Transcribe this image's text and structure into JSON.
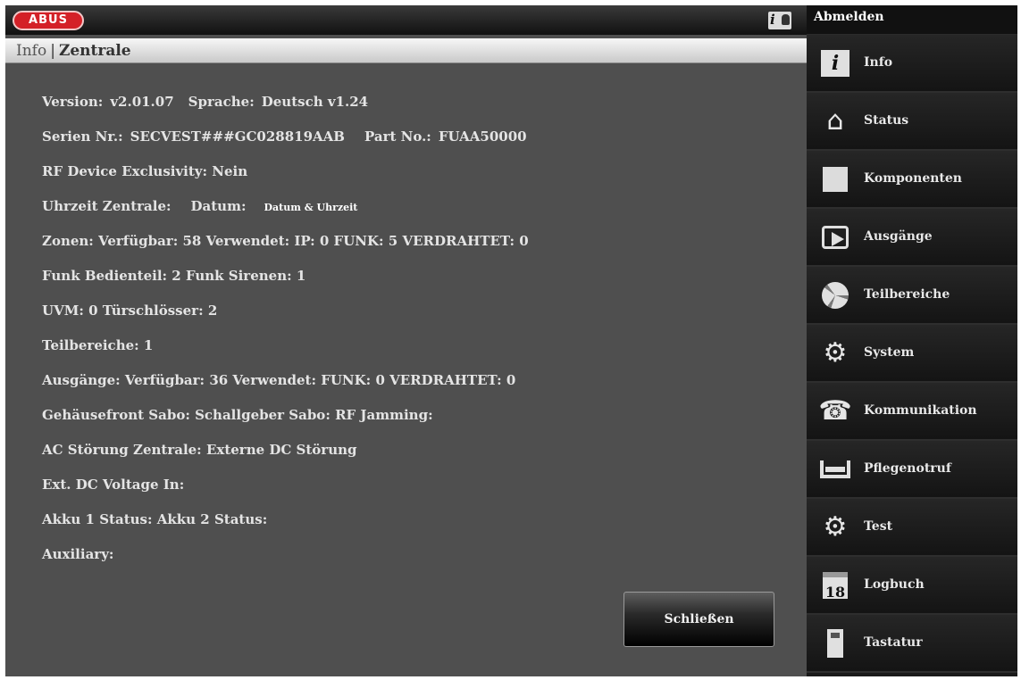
{
  "header": {
    "logo": "ABUS",
    "logout_label": "Abmelden"
  },
  "breadcrumb": {
    "parent": "Info",
    "separator": "|",
    "current": "Zentrale"
  },
  "info": {
    "version_label": "Version:",
    "version_value": "v2.01.07",
    "language_label": "Sprache:",
    "language_value": "Deutsch v1.24",
    "serial_label": "Serien Nr.:",
    "serial_value": "SECVEST###GC028819AAB",
    "part_label": "Part No.:",
    "part_value": "FUAA50000",
    "rf_exclusivity": "RF Device Exclusivity: Nein",
    "time_label": "Uhrzeit Zentrale:",
    "date_label": "Datum:",
    "datetime_value": "Datum & Uhrzeit",
    "zones": "Zonen:  Verfügbar: 58   Verwendet:  IP: 0  FUNK: 5  VERDRAHTET: 0",
    "keypads_sirens": "Funk Bedienteil:  2   Funk Sirenen:  1",
    "uvm_locks": "UVM:  0   Türschlösser:  2",
    "partitions": "Teilbereiche: 1",
    "outputs": "Ausgänge: Verfügbar: 36  Verwendet:  FUNK: 0  VERDRAHTET: 0",
    "tamper": "Gehäusefront Sabo:    Schallgeber Sabo:    RF Jamming:",
    "ac_fault": "AC Störung Zentrale:    Externe DC Störung",
    "ext_dc": "Ext. DC Voltage In:",
    "battery": "Akku 1 Status:    Akku 2 Status:",
    "auxiliary": "Auxiliary:"
  },
  "buttons": {
    "close_label": "Schließen"
  },
  "sidebar": {
    "items": [
      {
        "label": "Info",
        "icon": "info-icon"
      },
      {
        "label": "Status",
        "icon": "house-icon"
      },
      {
        "label": "Komponenten",
        "icon": "square-icon"
      },
      {
        "label": "Ausgänge",
        "icon": "exit-icon"
      },
      {
        "label": "Teilbereiche",
        "icon": "pie-icon"
      },
      {
        "label": "System",
        "icon": "gears-icon"
      },
      {
        "label": "Kommunikation",
        "icon": "telephone-icon"
      },
      {
        "label": "Pflegenotruf",
        "icon": "bed-icon"
      },
      {
        "label": "Test",
        "icon": "gears-icon"
      },
      {
        "label": "Logbuch",
        "icon": "calendar-icon"
      },
      {
        "label": "Tastatur",
        "icon": "keypad-icon"
      }
    ],
    "calendar_day": "18"
  },
  "colors": {
    "panel_bg": "#4f4f4f",
    "sidebar_bg": "#1a1a1a",
    "logo_red": "#d42027"
  }
}
